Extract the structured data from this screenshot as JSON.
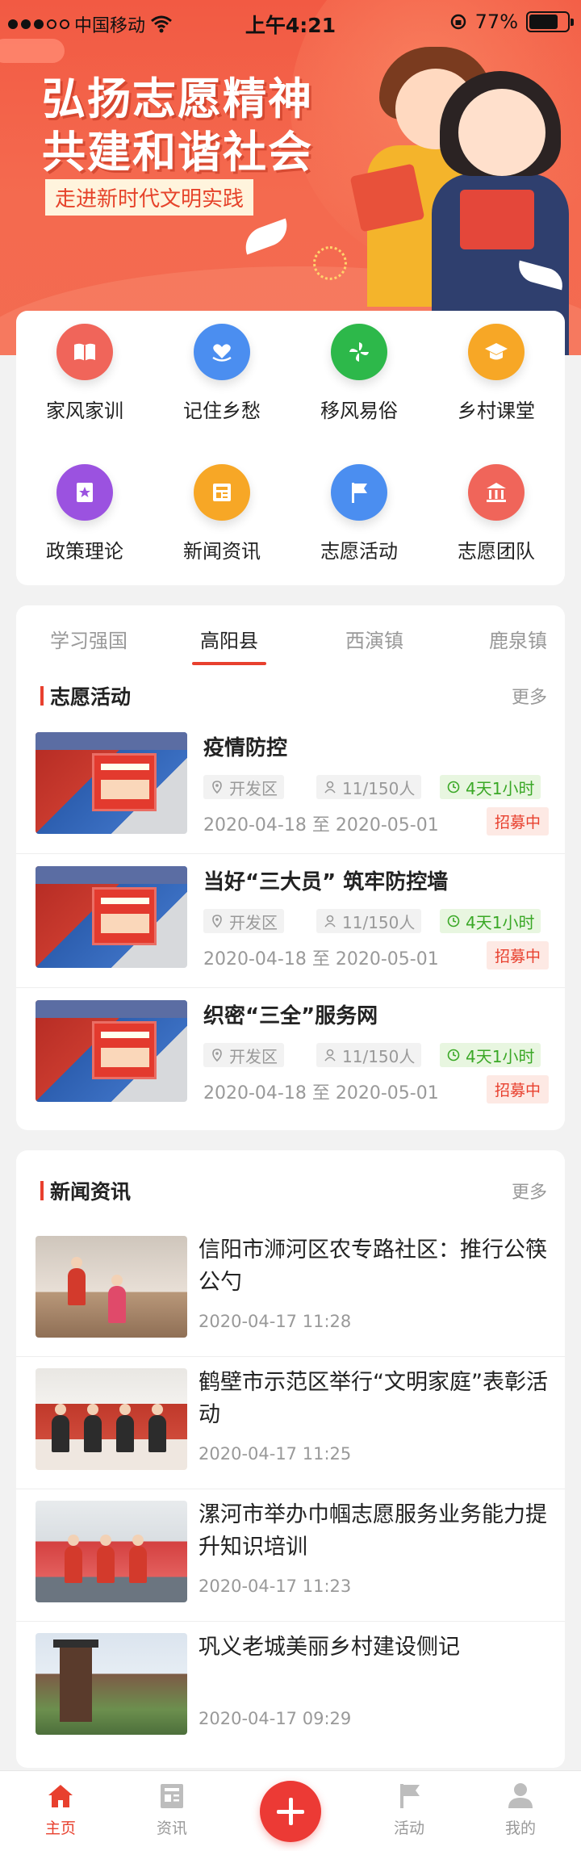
{
  "status_bar": {
    "carrier": "中国移动",
    "time": "上午4:21",
    "battery": "77%"
  },
  "banner": {
    "title_line1": "弘扬志愿精神",
    "title_line2": "共建和谐社会",
    "subtitle": "走进新时代文明实践"
  },
  "categories": [
    {
      "label": "家风家训",
      "icon": "book-icon",
      "color": "#f0655a"
    },
    {
      "label": "记住乡愁",
      "icon": "heart-hand-icon",
      "color": "#4b8ef0"
    },
    {
      "label": "移风易俗",
      "icon": "pinwheel-icon",
      "color": "#2db84a"
    },
    {
      "label": "乡村课堂",
      "icon": "graduation-cap-icon",
      "color": "#f7a726"
    },
    {
      "label": "政策理论",
      "icon": "star-book-icon",
      "color": "#9b52e0"
    },
    {
      "label": "新闻资讯",
      "icon": "news-icon",
      "color": "#f7a726"
    },
    {
      "label": "志愿活动",
      "icon": "flag-icon",
      "color": "#4b8ef0"
    },
    {
      "label": "志愿团队",
      "icon": "institution-icon",
      "color": "#f0655a"
    }
  ],
  "region_tabs": [
    "学习强国",
    "高阳县",
    "西演镇",
    "鹿泉镇"
  ],
  "active_region_tab": 1,
  "volunteer": {
    "title": "志愿活动",
    "more": "更多",
    "items": [
      {
        "title": "疫情防控",
        "location": "开发区",
        "people": "11/150人",
        "remaining": "4天1小时",
        "dates": "2020-04-18 至 2020-05-01",
        "status": "招募中"
      },
      {
        "title": "当好“三大员” 筑牢防控墙",
        "location": "开发区",
        "people": "11/150人",
        "remaining": "4天1小时",
        "dates": "2020-04-18 至 2020-05-01",
        "status": "招募中"
      },
      {
        "title": "织密“三全”服务网",
        "location": "开发区",
        "people": "11/150人",
        "remaining": "4天1小时",
        "dates": "2020-04-18 至 2020-05-01",
        "status": "招募中"
      }
    ]
  },
  "news": {
    "title": "新闻资讯",
    "more": "更多",
    "items": [
      {
        "title": "信阳市浉河区农专路社区：推行公筷公勺",
        "time": "2020-04-17 11:28"
      },
      {
        "title": "鹤壁市示范区举行“文明家庭”表彰活动",
        "time": "2020-04-17 11:25"
      },
      {
        "title": "漯河市举办巾帼志愿服务业务能力提升知识培训",
        "time": "2020-04-17 11:23"
      },
      {
        "title": "巩义老城美丽乡村建设侧记",
        "time": "2020-04-17 09:29"
      }
    ]
  },
  "tabbar": [
    {
      "label": "主页",
      "icon": "home-icon"
    },
    {
      "label": "资讯",
      "icon": "news-icon"
    },
    {
      "label": "",
      "icon": "plus-icon"
    },
    {
      "label": "活动",
      "icon": "flag-icon"
    },
    {
      "label": "我的",
      "icon": "user-icon"
    }
  ],
  "colors": {
    "accent": "#e8402e",
    "banner": "#f25a43",
    "green": "#3aa826"
  }
}
